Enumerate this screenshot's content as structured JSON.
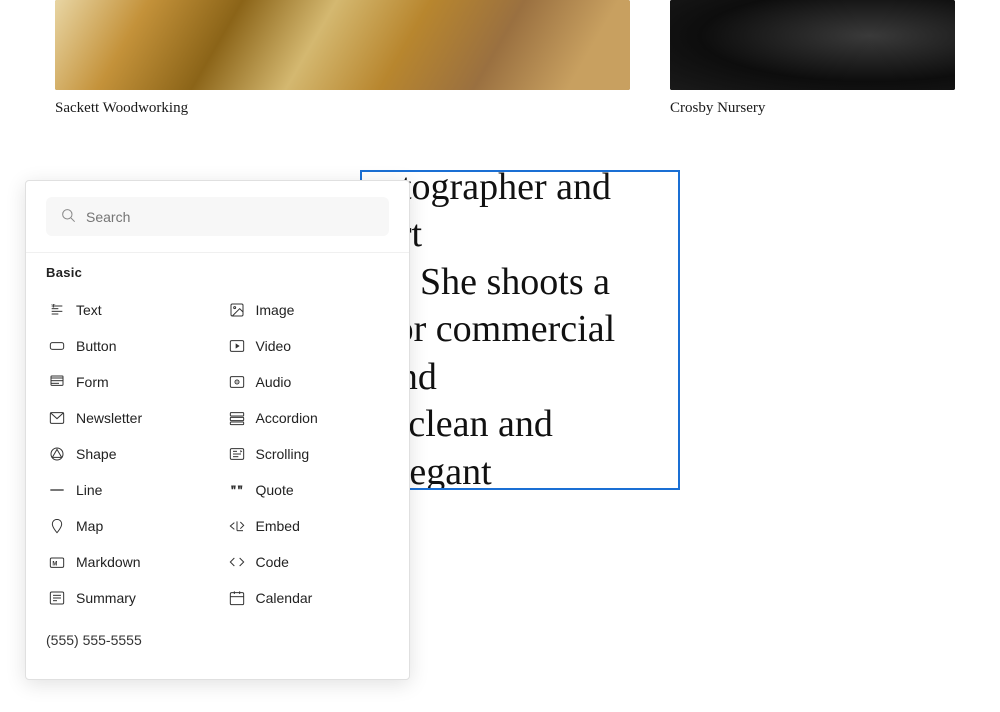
{
  "gallery": {
    "left_caption": "Sackett Woodworking",
    "right_caption": "Crosby Nursery"
  },
  "panel": {
    "search_placeholder": "Search",
    "section_basic": "Basic",
    "items": [
      {
        "id": "text",
        "label": "Text",
        "icon": "text-icon",
        "col": 0
      },
      {
        "id": "image",
        "label": "Image",
        "icon": "image-icon",
        "col": 1
      },
      {
        "id": "button",
        "label": "Button",
        "icon": "button-icon",
        "col": 0
      },
      {
        "id": "video",
        "label": "Video",
        "icon": "video-icon",
        "col": 1
      },
      {
        "id": "form",
        "label": "Form",
        "icon": "form-icon",
        "col": 0
      },
      {
        "id": "audio",
        "label": "Audio",
        "icon": "audio-icon",
        "col": 1
      },
      {
        "id": "newsletter",
        "label": "Newsletter",
        "icon": "newsletter-icon",
        "col": 0
      },
      {
        "id": "accordion",
        "label": "Accordion",
        "icon": "accordion-icon",
        "col": 1
      },
      {
        "id": "shape",
        "label": "Shape",
        "icon": "shape-icon",
        "col": 0
      },
      {
        "id": "scrolling",
        "label": "Scrolling",
        "icon": "scrolling-icon",
        "col": 1
      },
      {
        "id": "line",
        "label": "Line",
        "icon": "line-icon",
        "col": 0
      },
      {
        "id": "quote",
        "label": "Quote",
        "icon": "quote-icon",
        "col": 1
      },
      {
        "id": "map",
        "label": "Map",
        "icon": "map-icon",
        "col": 0
      },
      {
        "id": "embed",
        "label": "Embed",
        "icon": "embed-icon",
        "col": 1
      },
      {
        "id": "markdown",
        "label": "Markdown",
        "icon": "markdown-icon",
        "col": 0
      },
      {
        "id": "code",
        "label": "Code",
        "icon": "code-icon",
        "col": 1
      },
      {
        "id": "summary",
        "label": "Summary",
        "icon": "summary-icon",
        "col": 0
      },
      {
        "id": "calendar",
        "label": "Calendar",
        "icon": "calendar-icon",
        "col": 1
      }
    ],
    "phone": "(555) 555-5555"
  },
  "text_block": {
    "content": "otographer and art\nn. She shoots a\nfor commercial and\na clean and elegant"
  }
}
